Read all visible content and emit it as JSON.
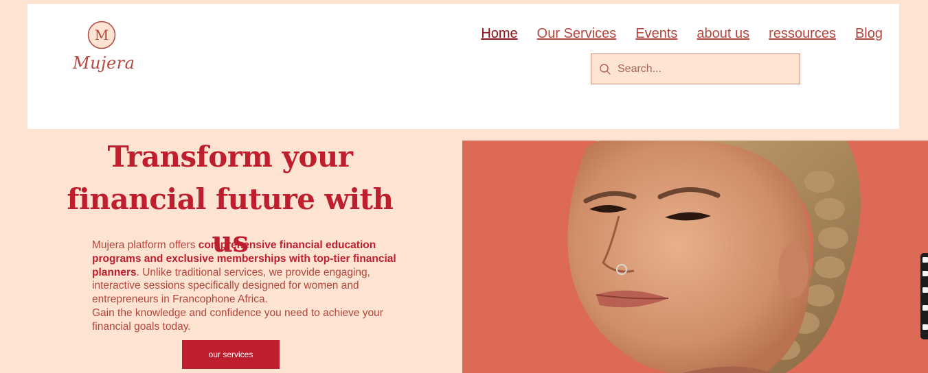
{
  "brand": {
    "name": "Mujera",
    "monogram": "M"
  },
  "nav": {
    "items": [
      {
        "label": "Home",
        "active": true
      },
      {
        "label": "Our Services",
        "active": false
      },
      {
        "label": "Events",
        "active": false
      },
      {
        "label": "about us",
        "active": false
      },
      {
        "label": "ressources",
        "active": false
      },
      {
        "label": "Blog",
        "active": false
      }
    ]
  },
  "search": {
    "placeholder": "Search...",
    "value": "",
    "icon": "search-icon"
  },
  "hero": {
    "title_line1": "Transform your",
    "title_line2": "financial future with us",
    "intro": " Mujera platform offers ",
    "intro_bold": "comprehensive financial education programs and exclusive memberships with top-tier financial planners",
    "intro_rest": ". Unlike traditional services, we provide engaging, interactive sessions specifically designed for women and entrepreneurs in Francophone Africa.",
    "intro_second": "Gain the knowledge and confidence you need to achieve your financial goals today.",
    "cta_label": "our services"
  },
  "colors": {
    "background": "#fde3d1",
    "header_bg": "#ffffff",
    "accent": "#be1e2d",
    "link": "#b5453c",
    "image_bg": "#dd6a56",
    "toolbar": "#1c1c1c"
  },
  "side_toolbar": {
    "icons": [
      "link-icon",
      "chat-icon",
      "square-icon",
      "copy-icon",
      "gear-icon"
    ]
  }
}
